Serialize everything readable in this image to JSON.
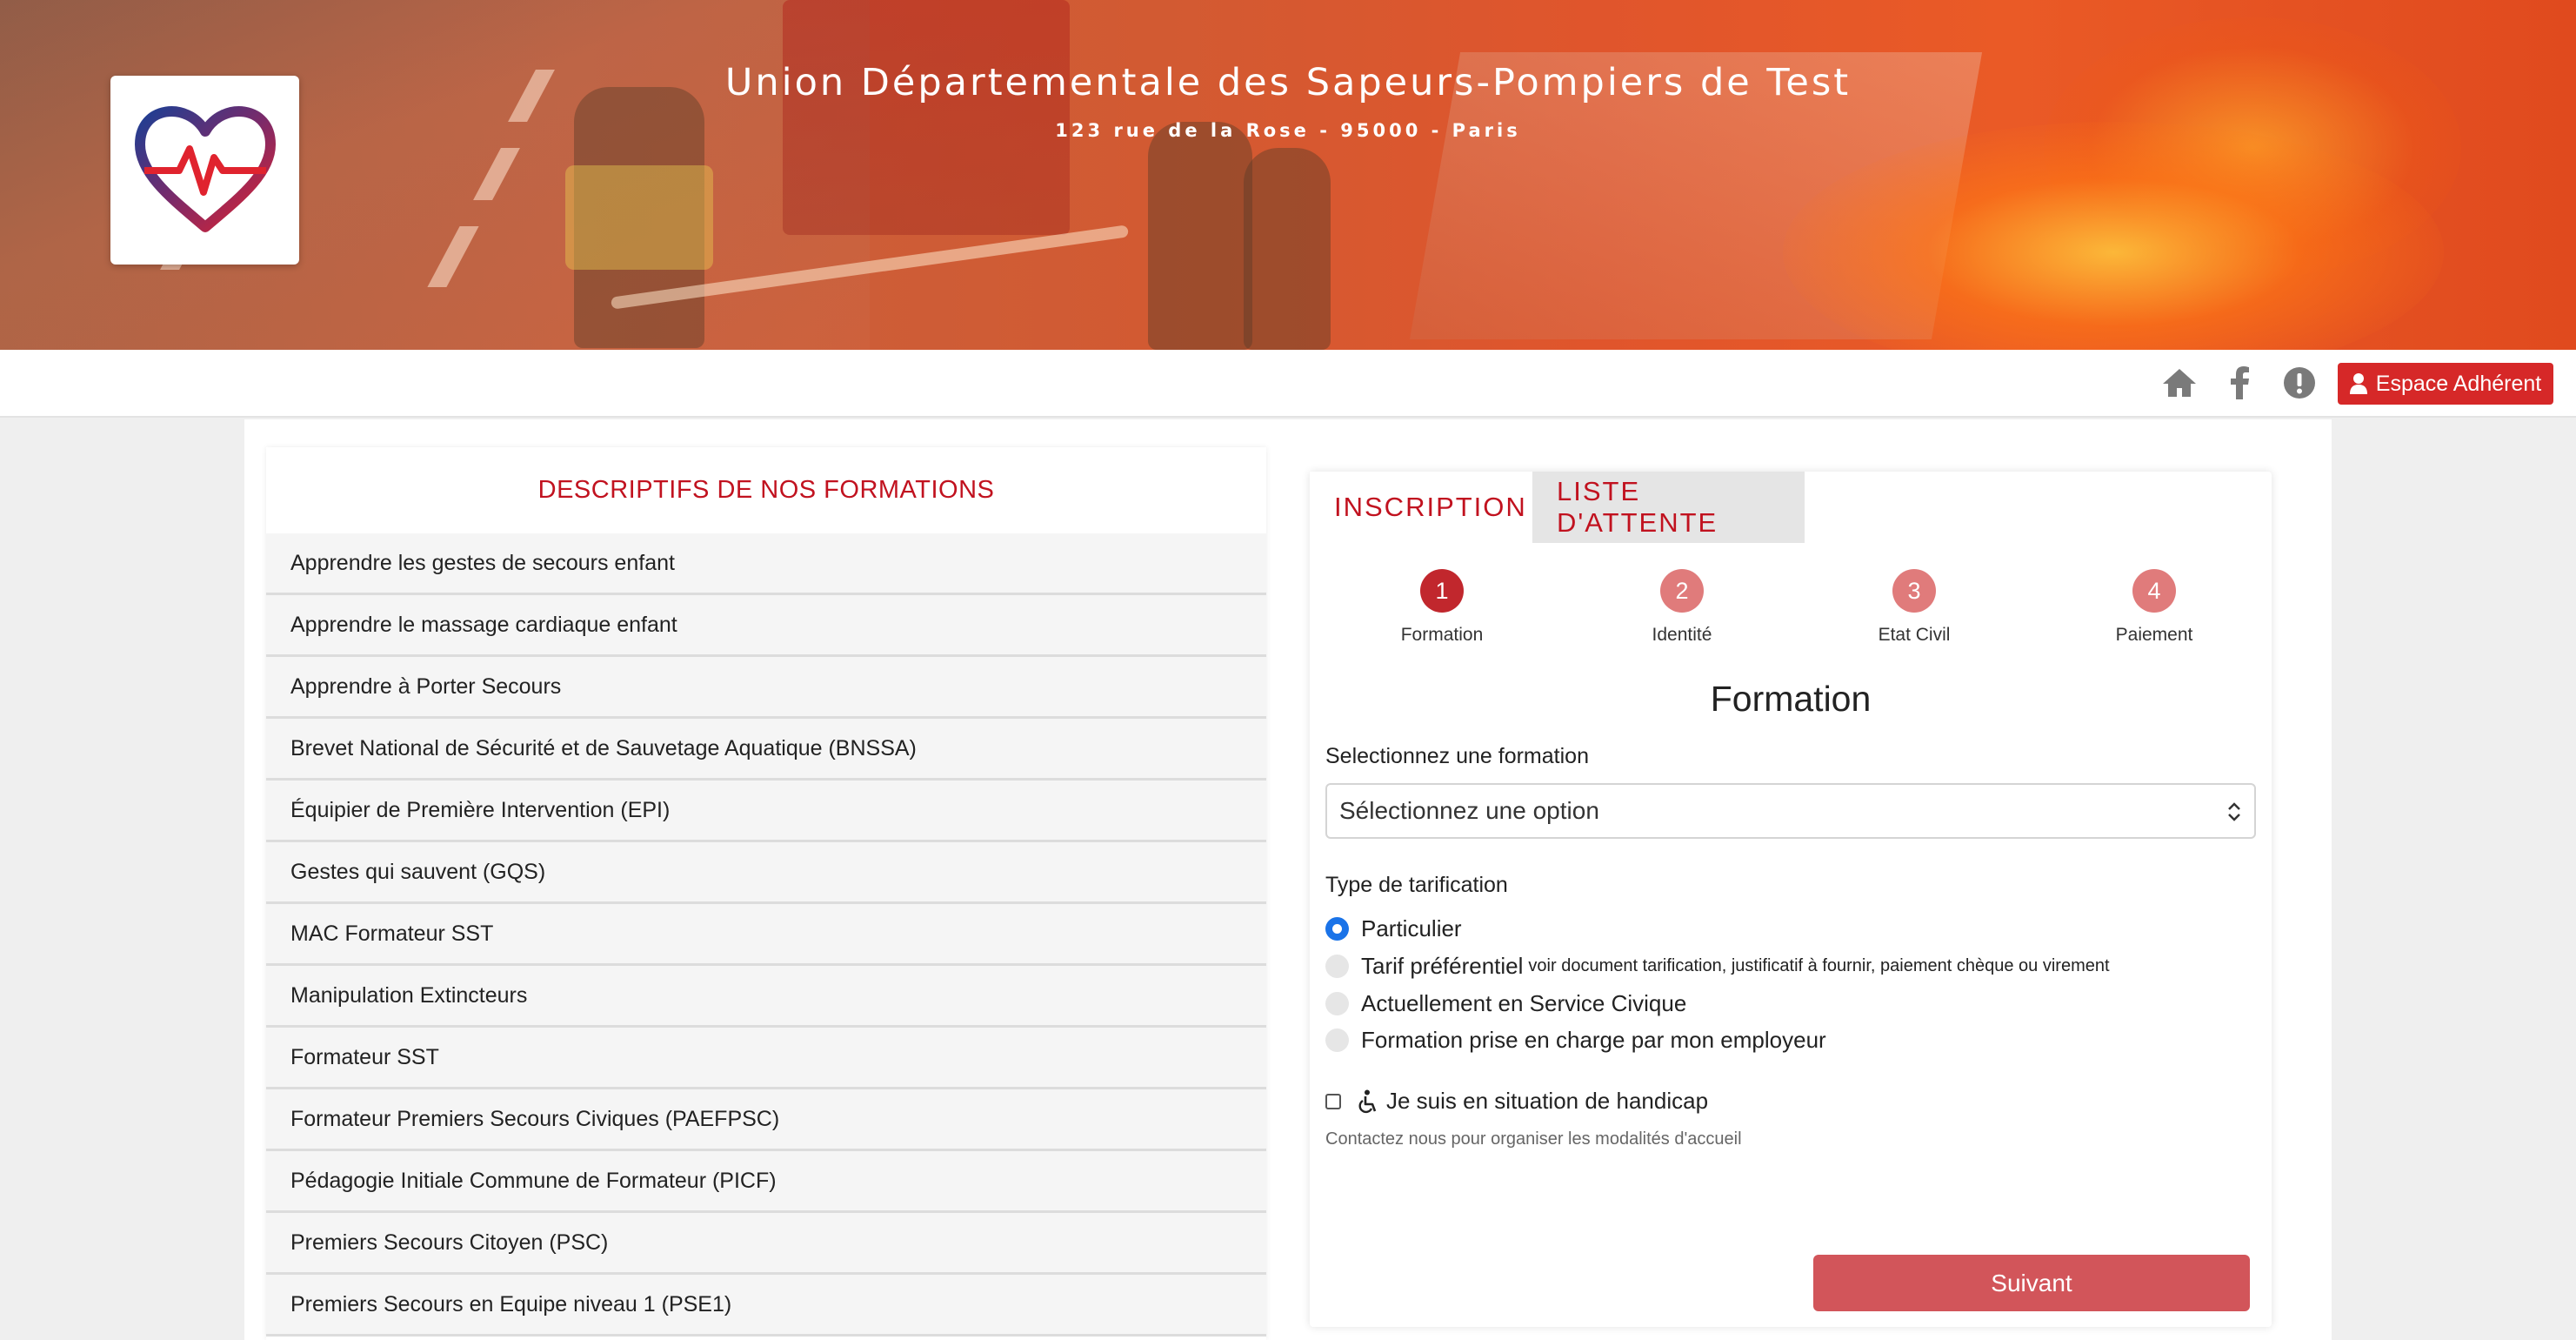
{
  "header": {
    "title": "Union Départementale des Sapeurs-Pompiers de Test",
    "address": "123 rue de la Rose - 95000 - Paris",
    "logo": "heart-pulse-logo"
  },
  "topbar": {
    "icons": [
      "home-icon",
      "facebook-icon",
      "alert-icon"
    ],
    "member_button": "Espace Adhérent"
  },
  "formations": {
    "title": "DESCRIPTIFS DE NOS FORMATIONS",
    "items": [
      "Apprendre les gestes de secours enfant",
      "Apprendre le massage cardiaque enfant",
      "Apprendre à Porter Secours",
      "Brevet National de Sécurité et de Sauvetage Aquatique (BNSSA)",
      "Équipier de Première Intervention (EPI)",
      "Gestes qui sauvent (GQS)",
      "MAC Formateur SST",
      "Manipulation Extincteurs",
      "Formateur SST",
      "Formateur Premiers Secours Civiques (PAEFPSC)",
      "Pédagogie Initiale Commune de Formateur (PICF)",
      "Premiers Secours Citoyen (PSC)",
      "Premiers Secours en Equipe niveau 1 (PSE1)"
    ]
  },
  "registration": {
    "tabs": [
      "INSCRIPTION",
      "LISTE D'ATTENTE"
    ],
    "steps": [
      {
        "number": "1",
        "label": "Formation",
        "active": true
      },
      {
        "number": "2",
        "label": "Identité",
        "active": false
      },
      {
        "number": "3",
        "label": "Etat Civil",
        "active": false
      },
      {
        "number": "4",
        "label": "Paiement",
        "active": false
      }
    ],
    "section_title": "Formation",
    "select_label": "Selectionnez une formation",
    "select_value": "Sélectionnez une option",
    "pricing_label": "Type de tarification",
    "pricing_options": [
      {
        "label": "Particulier",
        "note": "",
        "checked": true
      },
      {
        "label": "Tarif préférentiel",
        "note": "voir document tarification, justificatif à fournir, paiement chèque ou virement",
        "checked": false
      },
      {
        "label": "Actuellement en Service Civique",
        "note": "",
        "checked": false
      },
      {
        "label": "Formation prise en charge par mon employeur",
        "note": "",
        "checked": false
      }
    ],
    "handicap_label": "Je suis en situation de handicap",
    "handicap_hint": "Contactez nous pour organiser les modalités d'accueil",
    "next_button": "Suivant"
  },
  "colors": {
    "brand_red": "#c1121f",
    "button_red": "#d62828",
    "step_active": "#c1272d",
    "step_inactive": "#e07b7b",
    "next_button": "#d2555a",
    "radio_checked": "#1a73e8"
  }
}
